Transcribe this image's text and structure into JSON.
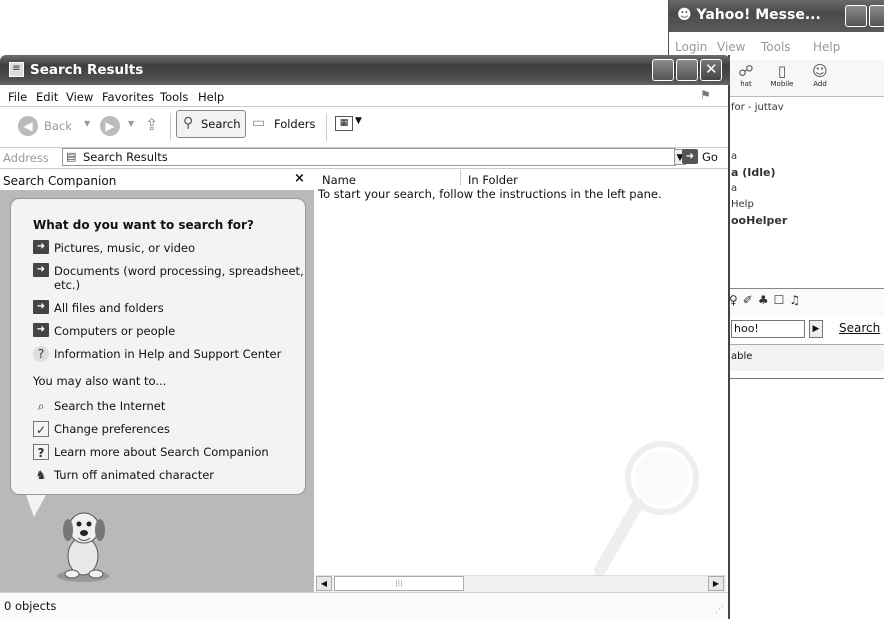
{
  "yahoo": {
    "title": "Yahoo! Messe...",
    "menu": [
      "Login",
      "View",
      "Tools",
      "Help"
    ],
    "tools": [
      {
        "label": "hat",
        "icon": "chat-icon"
      },
      {
        "label": "Mobile",
        "icon": "mobile-icon"
      },
      {
        "label": "Add",
        "icon": "add-icon"
      }
    ],
    "lines": [
      "for - juttav",
      "a",
      "a (Idle)",
      "a",
      "Help",
      "ooHelper"
    ],
    "search_value": "hoo!",
    "search_button": "Search",
    "status_text": "able"
  },
  "explorer": {
    "title": "Search Results",
    "menu": [
      "File",
      "Edit",
      "View",
      "Favorites",
      "Tools",
      "Help"
    ],
    "toolbar": {
      "back": "Back",
      "search": "Search",
      "folders": "Folders"
    },
    "address": {
      "label": "Address",
      "value": "Search Results",
      "go": "Go"
    },
    "companion": {
      "header": "Search Companion",
      "question": "What do you want to search for?",
      "options": [
        "Pictures, music, or video",
        "Documents (word processing, spreadsheet, etc.)",
        "All files and folders",
        "Computers or people",
        "Information in Help and Support Center"
      ],
      "also_label": "You may also want to...",
      "also": [
        "Search the Internet",
        "Change preferences",
        "Learn more about Search Companion",
        "Turn off animated character"
      ]
    },
    "columns": [
      "Name",
      "In Folder"
    ],
    "message": "To start your search, follow the instructions in the left pane.",
    "status": "0 objects"
  }
}
